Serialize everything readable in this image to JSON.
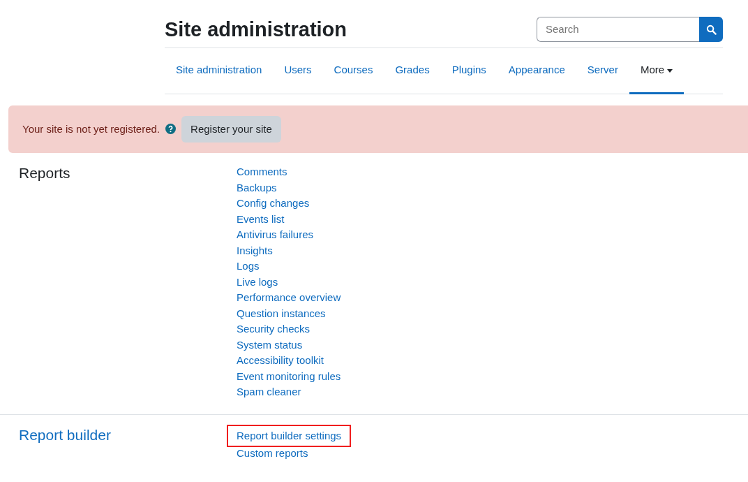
{
  "page_title": "Site administration",
  "search": {
    "placeholder": "Search"
  },
  "tabs": [
    {
      "label": "Site administration",
      "selected": false,
      "dropdown": false
    },
    {
      "label": "Users",
      "selected": false,
      "dropdown": false
    },
    {
      "label": "Courses",
      "selected": false,
      "dropdown": false
    },
    {
      "label": "Grades",
      "selected": false,
      "dropdown": false
    },
    {
      "label": "Plugins",
      "selected": false,
      "dropdown": false
    },
    {
      "label": "Appearance",
      "selected": false,
      "dropdown": false
    },
    {
      "label": "Server",
      "selected": false,
      "dropdown": false
    },
    {
      "label": "More",
      "selected": true,
      "dropdown": true
    }
  ],
  "alert": {
    "message": "Your site is not yet registered.",
    "button": "Register your site"
  },
  "sections": [
    {
      "heading": "Reports",
      "heading_is_link": false,
      "links": [
        {
          "label": "Comments",
          "highlighted": false
        },
        {
          "label": "Backups",
          "highlighted": false
        },
        {
          "label": "Config changes",
          "highlighted": false
        },
        {
          "label": "Events list",
          "highlighted": false
        },
        {
          "label": "Antivirus failures",
          "highlighted": false
        },
        {
          "label": "Insights",
          "highlighted": false
        },
        {
          "label": "Logs",
          "highlighted": false
        },
        {
          "label": "Live logs",
          "highlighted": false
        },
        {
          "label": "Performance overview",
          "highlighted": false
        },
        {
          "label": "Question instances",
          "highlighted": false
        },
        {
          "label": "Security checks",
          "highlighted": false
        },
        {
          "label": "System status",
          "highlighted": false
        },
        {
          "label": "Accessibility toolkit",
          "highlighted": false
        },
        {
          "label": "Event monitoring rules",
          "highlighted": false
        },
        {
          "label": "Spam cleaner",
          "highlighted": false
        }
      ]
    },
    {
      "heading": "Report builder",
      "heading_is_link": true,
      "links": [
        {
          "label": "Report builder settings",
          "highlighted": true
        },
        {
          "label": "Custom reports",
          "highlighted": false
        }
      ]
    }
  ]
}
